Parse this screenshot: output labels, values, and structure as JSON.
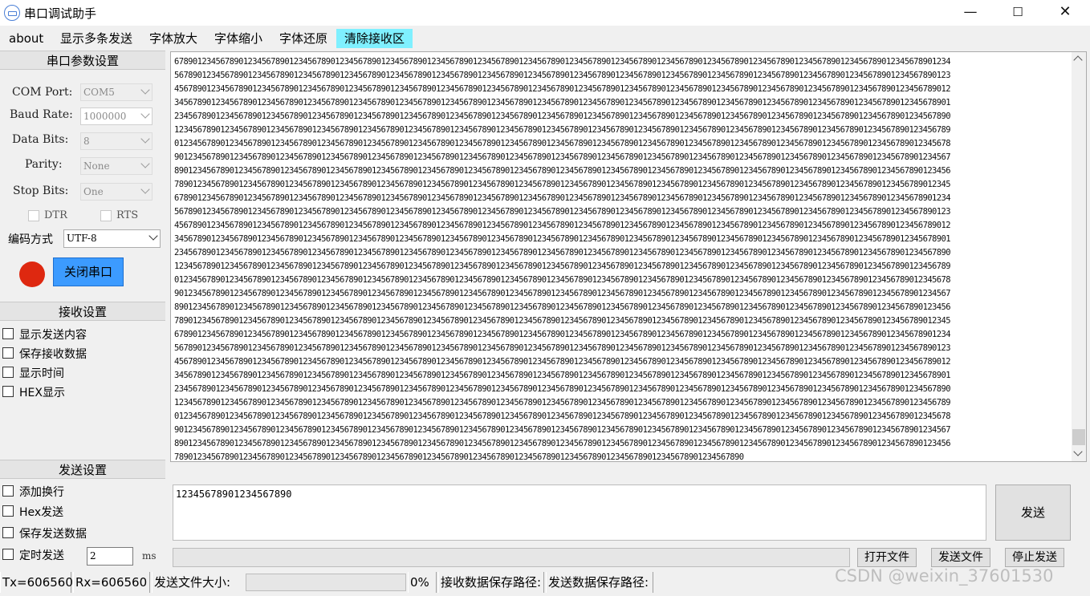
{
  "window": {
    "title": "串口调试助手",
    "minimize_glyph": "—",
    "maximize_glyph": "☐",
    "close_glyph": "✕"
  },
  "menu": {
    "items": [
      {
        "label": "about"
      },
      {
        "label": "显示多条发送"
      },
      {
        "label": "字体放大"
      },
      {
        "label": "字体缩小"
      },
      {
        "label": "字体还原"
      },
      {
        "label": "清除接收区",
        "highlight": "#7ff0ff"
      }
    ]
  },
  "serial_params": {
    "header": "串口参数设置",
    "com_port": {
      "label": "COM Port:",
      "value": "COM5"
    },
    "baud_rate": {
      "label": "Baud Rate:",
      "value": "1000000"
    },
    "data_bits": {
      "label": "Data Bits:",
      "value": "8"
    },
    "parity": {
      "label": "Parity:",
      "value": "None"
    },
    "stop_bits": {
      "label": "Stop Bits:",
      "value": "One"
    },
    "dtr": {
      "label": "DTR",
      "checked": false
    },
    "rts": {
      "label": "RTS",
      "checked": false
    },
    "encoding": {
      "label": "编码方式",
      "value": "UTF-8"
    },
    "status_led_color": "#de2810",
    "toggle_button": "关闭串口",
    "toggle_button_color": "#3c9bff"
  },
  "receive_settings": {
    "header": "接收设置",
    "options": [
      {
        "label": "显示发送内容",
        "checked": false
      },
      {
        "label": "保存接收数据",
        "checked": false
      },
      {
        "label": "显示时间",
        "checked": false
      },
      {
        "label": "HEX显示",
        "checked": false
      }
    ]
  },
  "send_settings": {
    "header": "发送设置",
    "options": [
      {
        "label": "添加换行",
        "checked": false
      },
      {
        "label": "Hex发送",
        "checked": false
      },
      {
        "label": "保存发送数据",
        "checked": false
      },
      {
        "label": "定时发送",
        "checked": false
      }
    ],
    "interval_value": "2",
    "interval_unit": "ms"
  },
  "receive_area": {
    "lines": [
      "6789012345678901234567890123456789012345678901234567890123456789012345678901234567890123456789012345678901234567890123456789012345678901234567890123456789012345678901234",
      "5678901234567890123456789012345678901234567890123456789012345678901234567890123456789012345678901234567890123456789012345678901234567890123456789012345678901234567890123",
      "4567890123456789012345678901234567890123456789012345678901234567890123456789012345678901234567890123456789012345678901234567890123456789012345678901234567890123456789012",
      "3456789012345678901234567890123456789012345678901234567890123456789012345678901234567890123456789012345678901234567890123456789012345678901234567890123456789012345678901",
      "2345678901234567890123456789012345678901234567890123456789012345678901234567890123456789012345678901234567890123456789012345678901234567890123456789012345678901234567890",
      "1234567890123456789012345678901234567890123456789012345678901234567890123456789012345678901234567890123456789012345678901234567890123456789012345678901234567890123456789",
      "0123456789012345678901234567890123456789012345678901234567890123456789012345678901234567890123456789012345678901234567890123456789012345678901234567890123456789012345678",
      "9012345678901234567890123456789012345678901234567890123456789012345678901234567890123456789012345678901234567890123456789012345678901234567890123456789012345678901234567",
      "8901234567890123456789012345678901234567890123456789012345678901234567890123456789012345678901234567890123456789012345678901234567890123456789012345678901234567890123456",
      "7890123456789012345678901234567890123456789012345678901234567890123456789012345678901234567890123456789012345678901234567890123456789012345678901234567890123456789012345",
      "6789012345678901234567890123456789012345678901234567890123456789012345678901234567890123456789012345678901234567890123456789012345678901234567890123456789012345678901234",
      "5678901234567890123456789012345678901234567890123456789012345678901234567890123456789012345678901234567890123456789012345678901234567890123456789012345678901234567890123",
      "4567890123456789012345678901234567890123456789012345678901234567890123456789012345678901234567890123456789012345678901234567890123456789012345678901234567890123456789012",
      "3456789012345678901234567890123456789012345678901234567890123456789012345678901234567890123456789012345678901234567890123456789012345678901234567890123456789012345678901",
      "2345678901234567890123456789012345678901234567890123456789012345678901234567890123456789012345678901234567890123456789012345678901234567890123456789012345678901234567890",
      "1234567890123456789012345678901234567890123456789012345678901234567890123456789012345678901234567890123456789012345678901234567890123456789012345678901234567890123456789",
      "0123456789012345678901234567890123456789012345678901234567890123456789012345678901234567890123456789012345678901234567890123456789012345678901234567890123456789012345678",
      "9012345678901234567890123456789012345678901234567890123456789012345678901234567890123456789012345678901234567890123456789012345678901234567890123456789012345678901234567",
      "8901234567890123456789012345678901234567890123456789012345678901234567890123456789012345678901234567890123456789012345678901234567890123456789012345678901234567890123456",
      "7890123456789012345678901234567890123456789012345678901234567890123456789012345678901234567890123456789012345678901234567890123456789012345678901234567890123456789012345",
      "6789012345678901234567890123456789012345678901234567890123456789012345678901234567890123456789012345678901234567890123456789012345678901234567890123456789012345678901234",
      "5678901234567890123456789012345678901234567890123456789012345678901234567890123456789012345678901234567890123456789012345678901234567890123456789012345678901234567890123",
      "4567890123456789012345678901234567890123456789012345678901234567890123456789012345678901234567890123456789012345678901234567890123456789012345678901234567890123456789012",
      "3456789012345678901234567890123456789012345678901234567890123456789012345678901234567890123456789012345678901234567890123456789012345678901234567890123456789012345678901",
      "2345678901234567890123456789012345678901234567890123456789012345678901234567890123456789012345678901234567890123456789012345678901234567890123456789012345678901234567890",
      "1234567890123456789012345678901234567890123456789012345678901234567890123456789012345678901234567890123456789012345678901234567890123456789012345678901234567890123456789",
      "0123456789012345678901234567890123456789012345678901234567890123456789012345678901234567890123456789012345678901234567890123456789012345678901234567890123456789012345678",
      "9012345678901234567890123456789012345678901234567890123456789012345678901234567890123456789012345678901234567890123456789012345678901234567890123456789012345678901234567",
      "8901234567890123456789012345678901234567890123456789012345678901234567890123456789012345678901234567890123456789012345678901234567890123456789012345678901234567890123456",
      "7890123456789012345678901234567890123456789012345678901234567890123456789012345678901234567890123456789012345678901234567890"
    ]
  },
  "send_area": {
    "text": "12345678901234567890",
    "send_button": "发送",
    "file_path": "",
    "open_file_button": "打开文件",
    "send_file_button": "发送文件",
    "stop_send_button": "停止发送"
  },
  "status_bar": {
    "tx": "Tx=606560",
    "rx": "Rx=606560",
    "send_file_size_label": "发送文件大小:",
    "progress_percent": "0%",
    "receive_save_path_label": "接收数据保存路径:",
    "send_save_path_label": "发送数据保存路径:"
  },
  "watermark": "CSDN @weixin_37601530"
}
